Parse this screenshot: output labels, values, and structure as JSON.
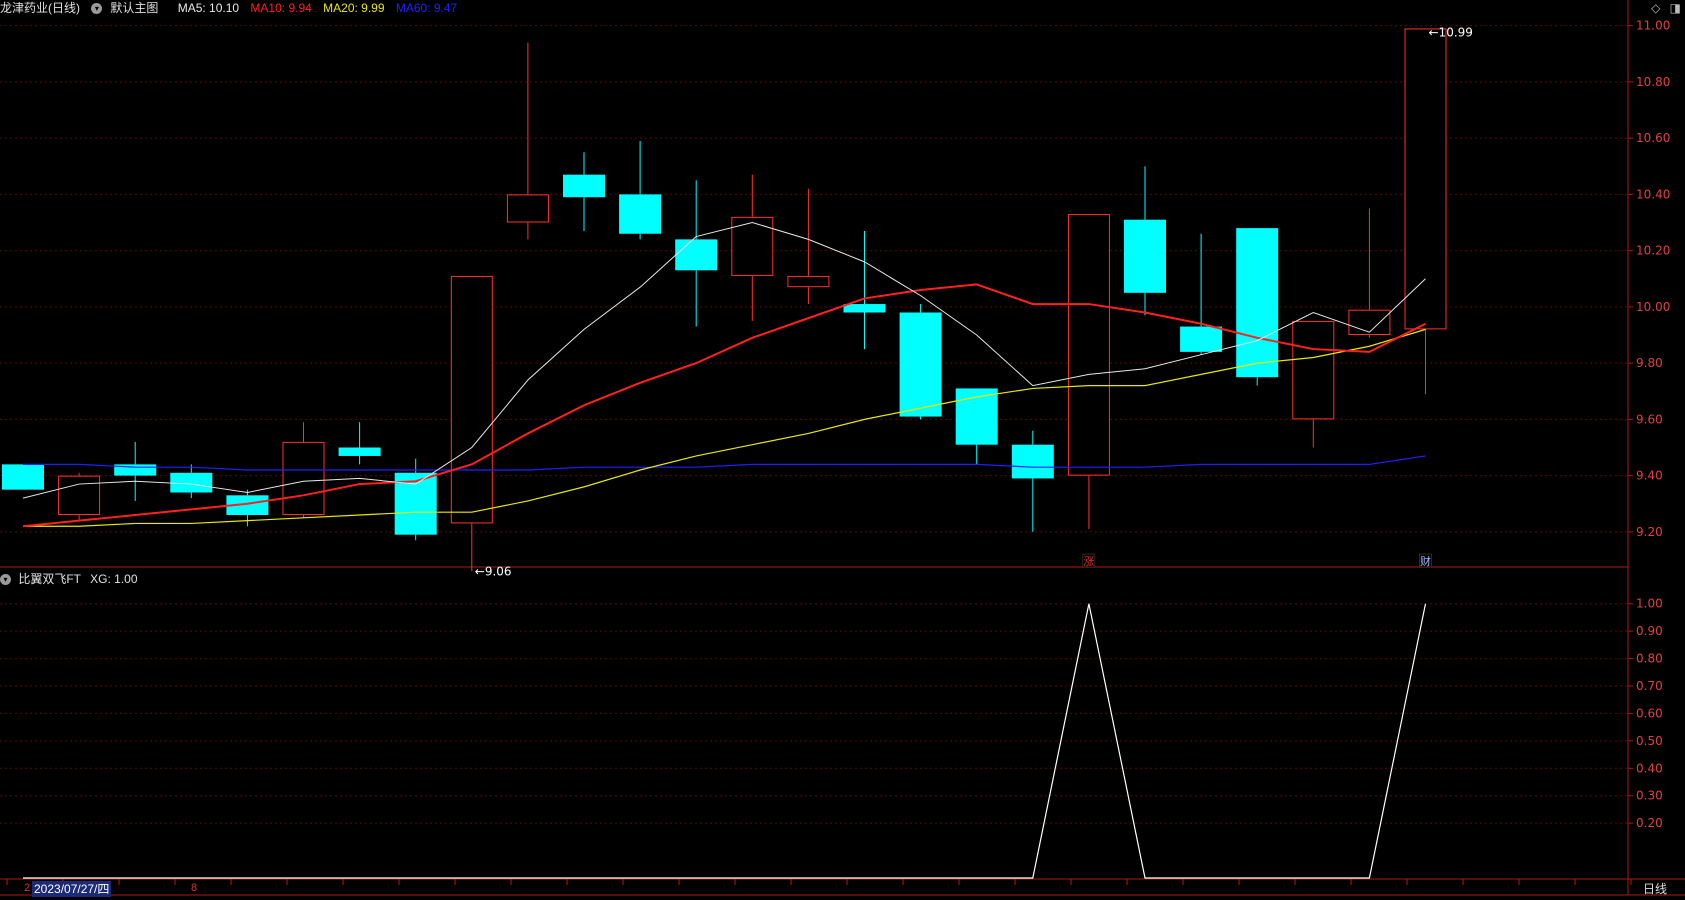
{
  "header": {
    "stock_name": "龙津药业(日线)",
    "template": "默认主图",
    "ma5": {
      "label": "MA5: 10.10",
      "color": "#e8e8e8"
    },
    "ma10": {
      "label": "MA10: 9.94",
      "color": "#ff2020"
    },
    "ma20": {
      "label": "MA20: 9.99",
      "color": "#e8e800"
    },
    "ma60": {
      "label": "MA60: 9.47",
      "color": "#2020ff"
    },
    "icons": [
      "diamond-icon",
      "layout-icon"
    ]
  },
  "indicator_header": {
    "name": "比翼双飞FT",
    "value": "XG: 1.00"
  },
  "footer": {
    "date": "2023/07/27/四",
    "period": "日线",
    "left_marks": [
      "2",
      "8"
    ]
  },
  "colors": {
    "up": "#ff3030",
    "down": "#00ffff",
    "axis": "#aa1a1a",
    "grid": "#5a0a0a",
    "axis_text": "#e04040"
  },
  "chart_data": [
    {
      "type": "candlestick",
      "ylim": [
        9.1,
        11.02
      ],
      "yticks": [
        "11.00",
        "10.80",
        "10.60",
        "10.40",
        "10.20",
        "10.00",
        "9.80",
        "9.60",
        "9.40",
        "9.20"
      ],
      "ytick_values": [
        11.0,
        10.8,
        10.6,
        10.4,
        10.2,
        10.0,
        9.8,
        9.6,
        9.4,
        9.2
      ],
      "candles": [
        {
          "o": 9.44,
          "c": 9.35,
          "h": 9.44,
          "l": 9.35
        },
        {
          "o": 9.26,
          "c": 9.4,
          "h": 9.41,
          "l": 9.24
        },
        {
          "o": 9.44,
          "c": 9.4,
          "h": 9.52,
          "l": 9.31
        },
        {
          "o": 9.41,
          "c": 9.34,
          "h": 9.44,
          "l": 9.32
        },
        {
          "o": 9.33,
          "c": 9.26,
          "h": 9.35,
          "l": 9.22
        },
        {
          "o": 9.26,
          "c": 9.52,
          "h": 9.59,
          "l": 9.25
        },
        {
          "o": 9.5,
          "c": 9.47,
          "h": 9.59,
          "l": 9.44
        },
        {
          "o": 9.41,
          "c": 9.19,
          "h": 9.46,
          "l": 9.17
        },
        {
          "o": 9.23,
          "c": 10.11,
          "h": 10.11,
          "l": 9.06
        },
        {
          "o": 10.3,
          "c": 10.4,
          "h": 10.94,
          "l": 10.24
        },
        {
          "o": 10.47,
          "c": 10.39,
          "h": 10.55,
          "l": 10.27
        },
        {
          "o": 10.4,
          "c": 10.26,
          "h": 10.59,
          "l": 10.24
        },
        {
          "o": 10.24,
          "c": 10.13,
          "h": 10.45,
          "l": 9.93
        },
        {
          "o": 10.11,
          "c": 10.32,
          "h": 10.47,
          "l": 9.95
        },
        {
          "o": 10.07,
          "c": 10.11,
          "h": 10.42,
          "l": 10.01
        },
        {
          "o": 10.01,
          "c": 9.98,
          "h": 10.27,
          "l": 9.85
        },
        {
          "o": 9.98,
          "c": 9.61,
          "h": 10.01,
          "l": 9.6
        },
        {
          "o": 9.71,
          "c": 9.51,
          "h": 9.71,
          "l": 9.44
        },
        {
          "o": 9.51,
          "c": 9.39,
          "h": 9.56,
          "l": 9.2
        },
        {
          "o": 9.4,
          "c": 10.33,
          "h": 10.33,
          "l": 9.21
        },
        {
          "o": 10.31,
          "c": 10.05,
          "h": 10.5,
          "l": 9.97
        },
        {
          "o": 9.93,
          "c": 9.84,
          "h": 10.26,
          "l": 9.83
        },
        {
          "o": 10.28,
          "c": 9.75,
          "h": 10.28,
          "l": 9.72
        },
        {
          "o": 9.6,
          "c": 9.95,
          "h": 9.95,
          "l": 9.5
        },
        {
          "o": 9.9,
          "c": 9.99,
          "h": 10.35,
          "l": 9.89
        },
        {
          "o": 9.92,
          "c": 10.99,
          "h": 10.99,
          "l": 9.69
        }
      ],
      "ma5": [
        9.32,
        9.37,
        9.38,
        9.37,
        9.34,
        9.38,
        9.39,
        9.37,
        9.5,
        9.74,
        9.92,
        10.07,
        10.25,
        10.3,
        10.24,
        10.16,
        10.04,
        9.9,
        9.72,
        9.76,
        9.78,
        9.83,
        9.88,
        9.98,
        9.91,
        10.1
      ],
      "ma10": [
        9.22,
        9.24,
        9.26,
        9.28,
        9.3,
        9.33,
        9.37,
        9.38,
        9.44,
        9.55,
        9.65,
        9.73,
        9.8,
        9.89,
        9.96,
        10.03,
        10.06,
        10.08,
        10.01,
        10.01,
        9.98,
        9.94,
        9.89,
        9.85,
        9.84,
        9.94
      ],
      "ma20": [
        9.22,
        9.22,
        9.23,
        9.23,
        9.24,
        9.25,
        9.26,
        9.27,
        9.27,
        9.31,
        9.36,
        9.42,
        9.47,
        9.51,
        9.55,
        9.6,
        9.64,
        9.68,
        9.71,
        9.72,
        9.72,
        9.76,
        9.8,
        9.82,
        9.86,
        9.92
      ],
      "ma60": [
        9.44,
        9.44,
        9.43,
        9.43,
        9.42,
        9.42,
        9.42,
        9.42,
        9.42,
        9.42,
        9.43,
        9.43,
        9.43,
        9.44,
        9.44,
        9.44,
        9.44,
        9.44,
        9.43,
        9.43,
        9.43,
        9.44,
        9.44,
        9.44,
        9.44,
        9.47
      ],
      "annotations": [
        {
          "index": 8,
          "price": 9.06,
          "label": "9.06",
          "position": "low"
        },
        {
          "index": 25,
          "price": 10.99,
          "label": "10.99",
          "position": "high"
        }
      ],
      "markers": [
        {
          "index": 19,
          "label": "涨",
          "color": "#e03030"
        },
        {
          "index": 25,
          "label": "财",
          "color": "#a0b8ff"
        }
      ]
    },
    {
      "type": "line",
      "name": "XG",
      "ylim": [
        0,
        1.05
      ],
      "yticks": [
        "1.00",
        "0.90",
        "0.80",
        "0.70",
        "0.60",
        "0.50",
        "0.40",
        "0.30",
        "0.20"
      ],
      "ytick_values": [
        1.0,
        0.9,
        0.8,
        0.7,
        0.6,
        0.5,
        0.4,
        0.3,
        0.2
      ],
      "values": [
        0,
        0,
        0,
        0,
        0,
        0,
        0,
        0,
        0,
        0,
        0,
        0,
        0,
        0,
        0,
        0,
        0,
        0,
        0,
        1,
        0,
        0,
        0,
        0,
        0,
        1
      ]
    }
  ]
}
